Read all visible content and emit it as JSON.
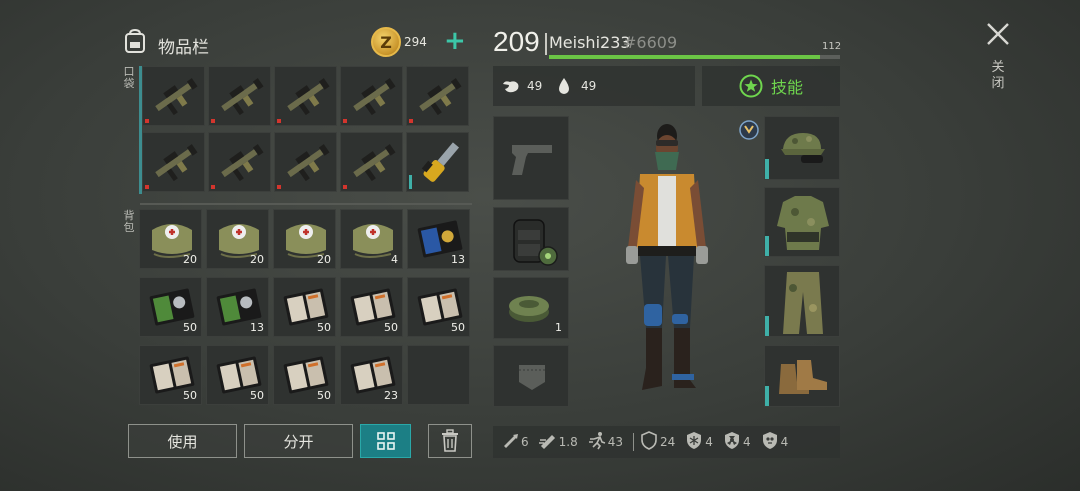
{
  "inventory": {
    "title": "物品栏",
    "coins": "294",
    "coin_symbol": "Z",
    "pocket_label": "口袋",
    "backpack_label": "背包",
    "pocket_items": [
      {
        "icon": "rifle-icon",
        "qty": ""
      },
      {
        "icon": "rifle-icon",
        "qty": ""
      },
      {
        "icon": "rifle-icon",
        "qty": ""
      },
      {
        "icon": "rifle-icon",
        "qty": ""
      },
      {
        "icon": "rifle-icon",
        "qty": ""
      },
      {
        "icon": "rifle-icon",
        "qty": ""
      },
      {
        "icon": "rifle-icon",
        "qty": ""
      },
      {
        "icon": "rifle-icon",
        "qty": ""
      },
      {
        "icon": "rifle-icon",
        "qty": ""
      },
      {
        "icon": "chainsaw-icon",
        "qty": ""
      }
    ],
    "backpack_items": [
      {
        "icon": "medkit-bag-icon",
        "qty": "20"
      },
      {
        "icon": "medkit-bag-icon",
        "qty": "20"
      },
      {
        "icon": "medkit-bag-icon",
        "qty": "20"
      },
      {
        "icon": "medkit-bag-icon",
        "qty": "4"
      },
      {
        "icon": "blue-badge-wallet-icon",
        "qty": "13"
      },
      {
        "icon": "green-badge-wallet-icon",
        "qty": "50"
      },
      {
        "icon": "green-badge-wallet-icon",
        "qty": "13"
      },
      {
        "icon": "notebook-icon",
        "qty": "50"
      },
      {
        "icon": "notebook-icon",
        "qty": "50"
      },
      {
        "icon": "notebook-icon",
        "qty": "50"
      },
      {
        "icon": "notebook-icon",
        "qty": "50"
      },
      {
        "icon": "notebook-icon",
        "qty": "50"
      },
      {
        "icon": "notebook-icon",
        "qty": "50"
      },
      {
        "icon": "notebook-icon",
        "qty": "23"
      },
      {
        "icon": "empty-slot",
        "qty": ""
      }
    ]
  },
  "buttons": {
    "use": "使用",
    "split": "分开"
  },
  "player": {
    "level": "209",
    "name": "Meishi233",
    "tag": "#6609",
    "xp_max": "112",
    "xp_fraction": 0.93,
    "food": "49",
    "water": "49",
    "skills_label": "技能"
  },
  "equipment": {
    "ammo_count": "1"
  },
  "combat_stats": [
    {
      "icon": "melee-damage-icon",
      "value": "6"
    },
    {
      "icon": "attack-speed-icon",
      "value": "1.8"
    },
    {
      "icon": "run-speed-icon",
      "value": "43"
    },
    {
      "icon": "armor-icon",
      "value": "24"
    },
    {
      "icon": "cold-resist-icon",
      "value": "4"
    },
    {
      "icon": "radiation-resist-icon",
      "value": "4"
    },
    {
      "icon": "infection-resist-icon",
      "value": "4"
    }
  ],
  "close_label": "关闭",
  "colors": {
    "accent_teal": "#1c7f85",
    "xp_green": "#6bc545",
    "skill_green": "#6fd64e",
    "coin_gold": "#e6b94a"
  }
}
